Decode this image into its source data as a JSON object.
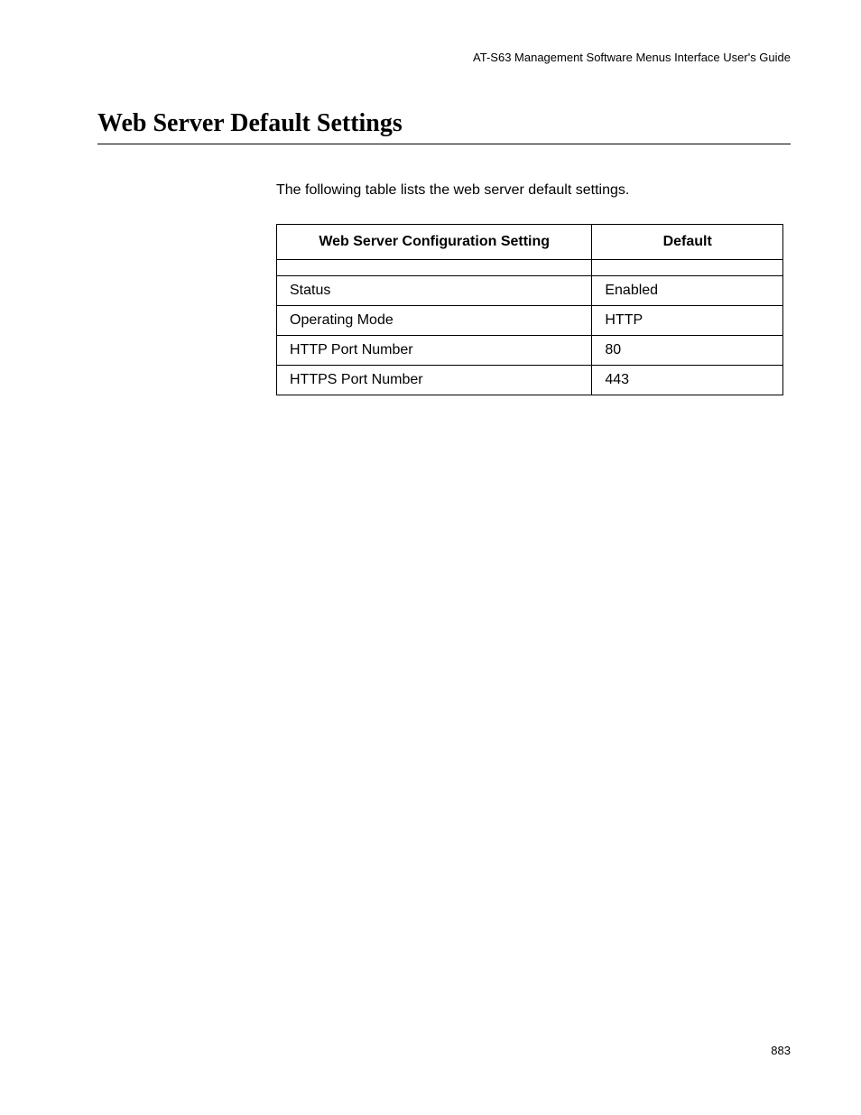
{
  "header": {
    "guide_title": "AT-S63 Management Software Menus Interface User's Guide"
  },
  "section": {
    "title": "Web Server Default Settings",
    "intro": "The following table lists the web server default settings."
  },
  "table": {
    "headers": {
      "setting": "Web Server Configuration Setting",
      "default": "Default"
    },
    "rows": [
      {
        "setting": "Status",
        "default": "Enabled"
      },
      {
        "setting": "Operating Mode",
        "default": "HTTP"
      },
      {
        "setting": "HTTP Port Number",
        "default": "80"
      },
      {
        "setting": "HTTPS Port Number",
        "default": "443"
      }
    ]
  },
  "footer": {
    "page_number": "883"
  }
}
